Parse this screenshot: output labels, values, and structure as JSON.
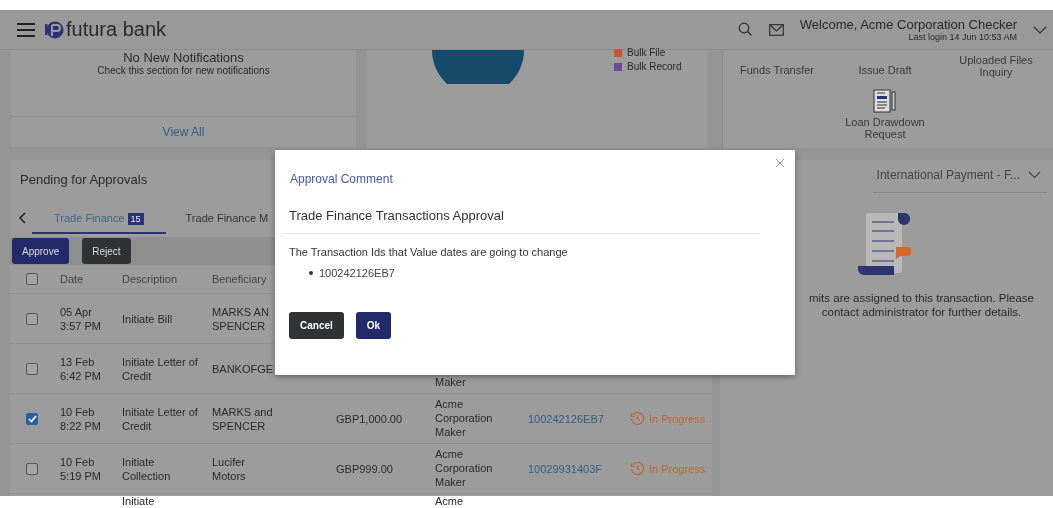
{
  "header": {
    "brand": "futura bank",
    "welcome": "Welcome, Acme Corporation Checker",
    "last_login": "Last login 14 Jun 10:53 AM"
  },
  "notifications": {
    "title": "No New Notifications",
    "subtitle": "Check this section for new notifications",
    "link": "View All"
  },
  "chart_card": {
    "legend": [
      {
        "label": "Bulk File",
        "color": "#c8553a"
      },
      {
        "label": "Bulk Record",
        "color": "#6a4a9a"
      }
    ]
  },
  "quick_links": [
    {
      "label": "Funds Transfer",
      "kind": "text"
    },
    {
      "label": "Issue Draft",
      "kind": "text"
    },
    {
      "label": "Uploaded Files Inquiry",
      "kind": "text"
    },
    {
      "label": "Loan Drawdown Request",
      "kind": "icon"
    }
  ],
  "pending": {
    "title": "Pending for Approvals",
    "tabs": [
      {
        "label": "Trade Finance",
        "badge": "15",
        "selected": true
      },
      {
        "label": "Trade Finance M",
        "selected": false
      }
    ],
    "actions": [
      "Approve",
      "Reject"
    ],
    "select_all": false,
    "columns": [
      "Date",
      "Description",
      "Beneficiary"
    ],
    "rows": [
      {
        "kind": "full",
        "checked": false,
        "date": "05 Apr",
        "time": "3:57 PM",
        "description": "Initiate Bill",
        "beneficiary": "MARKS AN SPENCER"
      },
      {
        "kind": "full",
        "checked": false,
        "date": "13 Feb",
        "time": "6:42 PM",
        "description": "Initiate Letter of Credit",
        "beneficiary": "BANKOFGE",
        "initiator": "Maker"
      },
      {
        "kind": "full",
        "checked": true,
        "date": "10 Feb",
        "time": "8:22 PM",
        "description": "Initiate Letter of Credit",
        "beneficiary": "MARKS and SPENCER",
        "amount": "GBP1,000.00",
        "initiator": "Acme Corporation Maker",
        "reference": "100242126EB7",
        "status": {
          "label": "In Progress",
          "kind": "progress"
        }
      },
      {
        "kind": "full",
        "checked": false,
        "date": "10 Feb",
        "time": "5:19 PM",
        "description": "Initiate Collection",
        "beneficiary": "Lucifer Motors",
        "amount": "GBP999.00",
        "initiator": "Acme Corporation Maker",
        "reference": "10029931403F",
        "status": {
          "label": "In Progress",
          "kind": "progress"
        }
      },
      {
        "kind": "cut",
        "description": "Initiate",
        "initiator": "Acme"
      }
    ]
  },
  "limits": {
    "dropdown": "International Payment - F...",
    "message": "mits are assigned to this transaction. Please contact administrator for further details."
  },
  "modal": {
    "title": "Approval Comment",
    "subtitle": "Trade Finance Transactions Approval",
    "text": "The Transaction Ids that Value dates are going to change",
    "ids": [
      "100242126EB7"
    ],
    "buttons": [
      "Cancel",
      "Ok"
    ]
  }
}
